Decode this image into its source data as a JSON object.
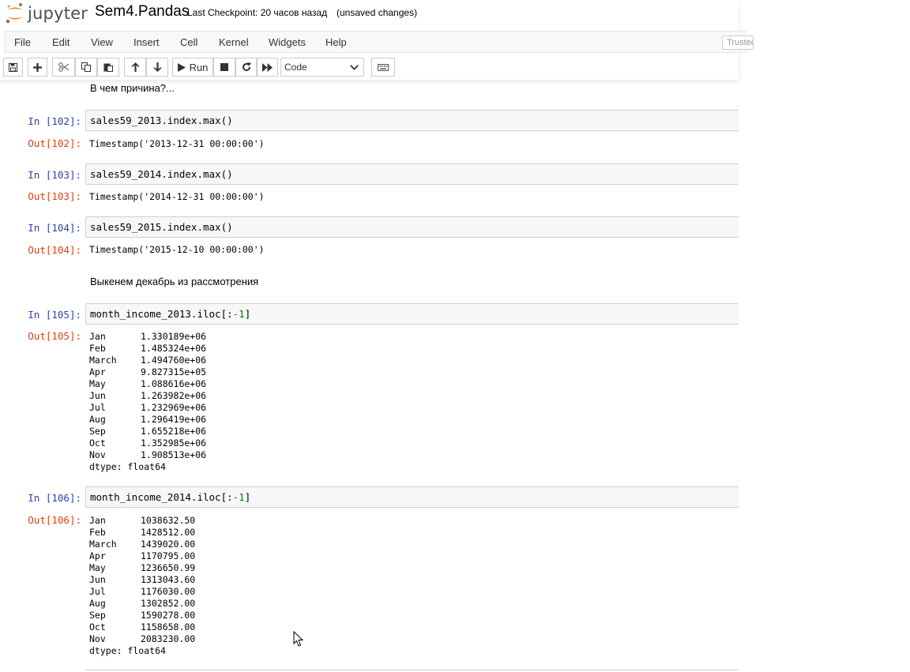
{
  "header": {
    "logo_text": "jupyter",
    "notebook_name": "Sem4.Pandas",
    "checkpoint": "Last Checkpoint: 20 часов назад",
    "autosave_status": "(unsaved changes)"
  },
  "menu": {
    "items": [
      "File",
      "Edit",
      "View",
      "Insert",
      "Cell",
      "Kernel",
      "Widgets",
      "Help"
    ],
    "trusted_label": "Trusted"
  },
  "toolbar": {
    "run_label": "Run",
    "cell_type": "Code",
    "buttons": [
      "save-icon",
      "add-cell-icon",
      "cut-icon",
      "copy-icon",
      "paste-icon",
      "move-up-icon",
      "move-down-icon",
      "run-icon",
      "interrupt-icon",
      "restart-icon",
      "restart-run-all-icon",
      "keyboard-icon"
    ]
  },
  "cells": {
    "md1": "В чем причина?...",
    "c102": {
      "in_prompt": "In [102]:",
      "code": "sales59_2013.index.max()",
      "out_prompt": "Out[102]:",
      "output": "Timestamp('2013-12-31 00:00:00')"
    },
    "c103": {
      "in_prompt": "In [103]:",
      "code": "sales59_2014.index.max()",
      "out_prompt": "Out[103]:",
      "output": "Timestamp('2014-12-31 00:00:00')"
    },
    "c104": {
      "in_prompt": "In [104]:",
      "code": "sales59_2015.index.max()",
      "out_prompt": "Out[104]:",
      "output": "Timestamp('2015-12-10 00:00:00')"
    },
    "md2": "Выкенем декабрь из рассмотрения",
    "c105": {
      "in_prompt": "In [105]:",
      "code_prefix": "month_income_2013.iloc[:",
      "code_num": "-1",
      "code_suffix": "]",
      "out_prompt": "Out[105]:",
      "rows": [
        {
          "label": "Jan",
          "value": "1.330189e+06"
        },
        {
          "label": "Feb",
          "value": "1.485324e+06"
        },
        {
          "label": "March",
          "value": "1.494760e+06"
        },
        {
          "label": "Apr",
          "value": "9.827315e+05"
        },
        {
          "label": "May",
          "value": "1.088616e+06"
        },
        {
          "label": "Jun",
          "value": "1.263982e+06"
        },
        {
          "label": "Jul",
          "value": "1.232969e+06"
        },
        {
          "label": "Aug",
          "value": "1.296419e+06"
        },
        {
          "label": "Sep",
          "value": "1.655218e+06"
        },
        {
          "label": "Oct",
          "value": "1.352985e+06"
        },
        {
          "label": "Nov",
          "value": "1.908513e+06"
        }
      ],
      "dtype": "dtype: float64"
    },
    "c106": {
      "in_prompt": "In [106]:",
      "code_prefix": "month_income_2014.iloc[:",
      "code_num": "-1",
      "code_suffix": "]",
      "out_prompt": "Out[106]:",
      "rows": [
        {
          "label": "Jan",
          "value": "1038632.50"
        },
        {
          "label": "Feb",
          "value": "1428512.00"
        },
        {
          "label": "March",
          "value": "1439020.00"
        },
        {
          "label": "Apr",
          "value": "1170795.00"
        },
        {
          "label": "May",
          "value": "1236650.99"
        },
        {
          "label": "Jun",
          "value": "1313043.60"
        },
        {
          "label": "Jul",
          "value": "1176030.00"
        },
        {
          "label": "Aug",
          "value": "1302852.00"
        },
        {
          "label": "Sep",
          "value": "1590278.00"
        },
        {
          "label": "Oct",
          "value": "1158658.00"
        },
        {
          "label": "Nov",
          "value": "2083230.00"
        }
      ],
      "dtype": "dtype: float64"
    }
  }
}
